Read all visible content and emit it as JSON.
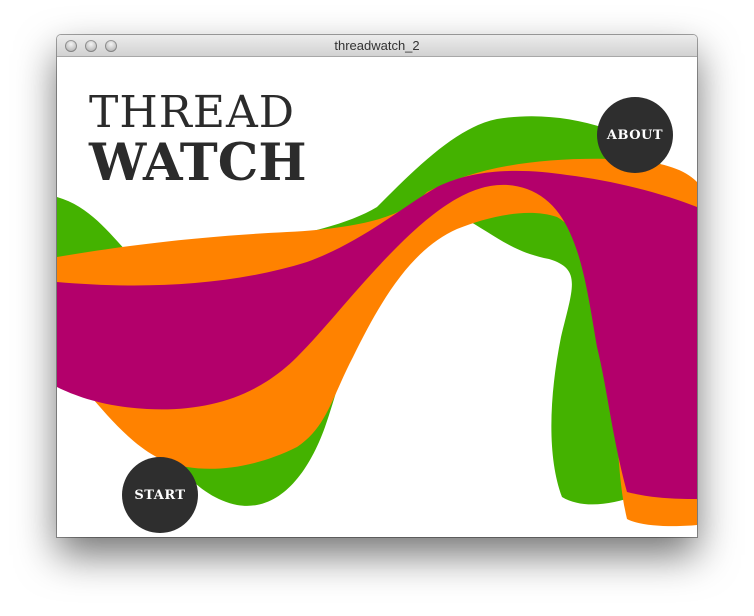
{
  "window": {
    "title": "threadwatch_2"
  },
  "logo": {
    "line1": "THREAD",
    "line2": "WATCH"
  },
  "buttons": {
    "about": "ABOUT",
    "start": "START"
  },
  "colors": {
    "green": "#44b200",
    "orange": "#ff8200",
    "magenta": "#b3006b",
    "button_bg": "#2e2e2e",
    "logo_text": "#2b2b2b"
  }
}
